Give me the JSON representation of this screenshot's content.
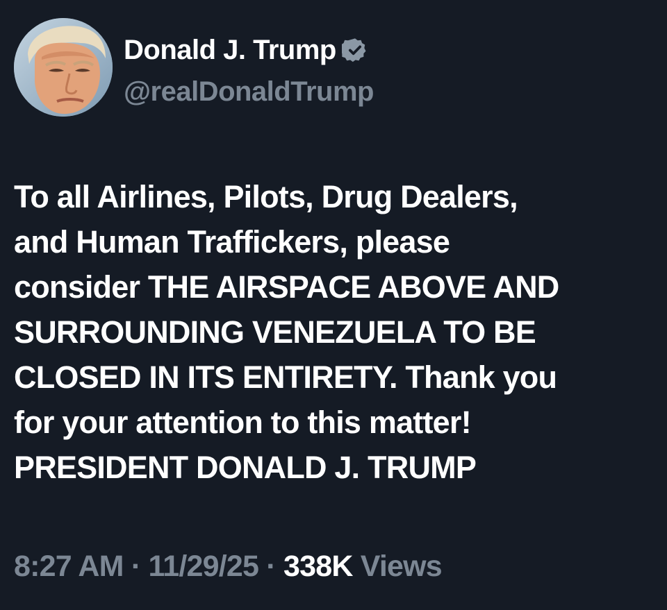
{
  "author": {
    "display_name": "Donald J. Trump",
    "handle": "@realDonaldTrump",
    "verified": true,
    "verified_badge_color": "#8b98a5",
    "avatar_icon": "profile-photo"
  },
  "tweet": {
    "lines": [
      "To all Airlines, Pilots, Drug Dealers,",
      "and Human Traffickers, please",
      "consider THE AIRSPACE ABOVE AND",
      "SURROUNDING VENEZUELA TO BE",
      "CLOSED IN ITS ENTIRETY. Thank you",
      "for your attention to this matter!",
      "PRESIDENT DONALD J. TRUMP"
    ]
  },
  "meta": {
    "time": "8:27 AM",
    "separator": "·",
    "date": "11/29/25",
    "views_count": "338K",
    "views_label": "Views"
  },
  "colors": {
    "background": "#151b25",
    "primary_text": "#ffffff",
    "secondary_text": "#7c8794"
  }
}
